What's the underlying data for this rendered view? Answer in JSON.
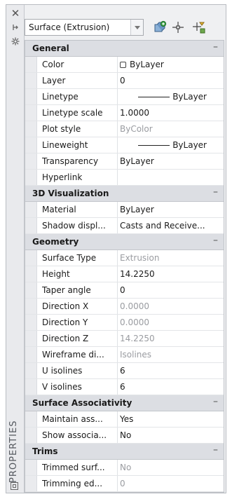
{
  "panel": {
    "title": "PROPERTIES",
    "side_icons": [
      "close-icon",
      "autohide-icon",
      "settings-icon",
      "properties-icon"
    ]
  },
  "toolbar": {
    "object_type": "Surface (Extrusion)",
    "buttons": [
      "toggle-pickadd-icon",
      "select-objects-icon",
      "quick-select-icon"
    ]
  },
  "sections": {
    "general": {
      "title": "General",
      "collapse": "–",
      "color_name": "Color",
      "color_value": "ByLayer",
      "layer_name": "Layer",
      "layer_value": "0",
      "linetype_name": "Linetype",
      "linetype_value": "ByLayer",
      "ltscale_name": "Linetype scale",
      "ltscale_value": "1.0000",
      "plotstyle_name": "Plot style",
      "plotstyle_value": "ByColor",
      "lineweight_name": "Lineweight",
      "lineweight_value": "ByLayer",
      "transparency_name": "Transparency",
      "transparency_value": "ByLayer",
      "hyperlink_name": "Hyperlink",
      "hyperlink_value": ""
    },
    "viz": {
      "title": "3D Visualization",
      "collapse": "–",
      "material_name": "Material",
      "material_value": "ByLayer",
      "shadow_name": "Shadow displ...",
      "shadow_value": "Casts and Receive..."
    },
    "geometry": {
      "title": "Geometry",
      "collapse": "–",
      "stype_name": "Surface Type",
      "stype_value": "Extrusion",
      "height_name": "Height",
      "height_value": "14.2250",
      "taper_name": "Taper angle",
      "taper_value": "0",
      "dirx_name": "Direction X",
      "dirx_value": "0.0000",
      "diry_name": "Direction Y",
      "diry_value": "0.0000",
      "dirz_name": "Direction Z",
      "dirz_value": "14.2250",
      "wire_name": "Wireframe di...",
      "wire_value": "Isolines",
      "uiso_name": "U isolines",
      "uiso_value": "6",
      "viso_name": "V isolines",
      "viso_value": "6"
    },
    "assoc": {
      "title": "Surface Associativity",
      "collapse": "–",
      "maintain_name": "Maintain ass...",
      "maintain_value": "Yes",
      "show_name": "Show associa...",
      "show_value": "No"
    },
    "trims": {
      "title": "Trims",
      "collapse": "–",
      "trimmed_name": "Trimmed surf...",
      "trimmed_value": "No",
      "trimming_name": "Trimming ed...",
      "trimming_value": "0"
    }
  }
}
